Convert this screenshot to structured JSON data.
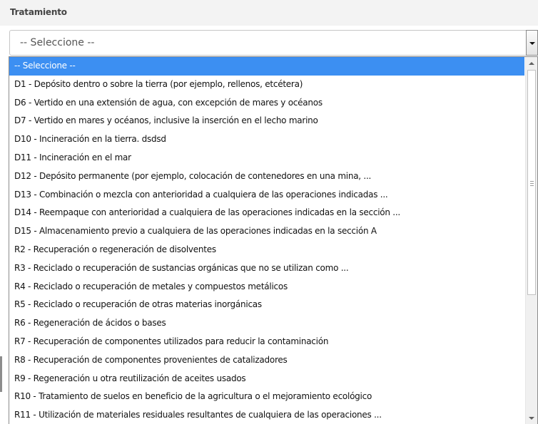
{
  "field": {
    "label": "Tratamiento",
    "selected_value": "-- Seleccione --"
  },
  "dropdown": {
    "options": [
      "-- Seleccione --",
      "D1 - Depósito dentro o sobre la tierra (por ejemplo, rellenos, etcétera)",
      "D6 - Vertido en una extensión de agua, con excepción de mares y océanos",
      "D7 - Vertido en mares y océanos, inclusive la inserción en el lecho marino",
      "D10 - Incineración en la tierra. dsdsd",
      "D11 - Incineración en el mar",
      "D12 - Depósito permanente (por ejemplo, colocación de contenedores en una mina, ...",
      "D13 - Combinación o mezcla con anterioridad a cualquiera de las operaciones indicadas ...",
      "D14 - Reempaque con anterioridad a cualquiera de las operaciones indicadas en la sección ...",
      "D15 - Almacenamiento previo a cualquiera de las operaciones indicadas en la sección A",
      "R2 - Recuperación o regeneración de disolventes",
      "R3 - Reciclado o recuperación de sustancias orgánicas que no se utilizan como ...",
      "R4 - Reciclado o recuperación de metales y compuestos metálicos",
      "R5 - Reciclado o recuperación de otras materias inorgánicas",
      "R6 - Regeneración de ácidos o bases",
      "R7 - Recuperación de componentes utilizados para reducir la contaminación",
      "R8 - Recuperación de componentes provenientes de catalizadores",
      "R9 - Regeneración u otra reutilización de aceites usados",
      "R10 - Tratamiento de suelos en beneficio de la agricultura o el mejoramiento ecológico",
      "R11 - Utilización de materiales residuales resultantes de cualquiera de las operaciones ..."
    ],
    "highlighted_index": 0
  },
  "icons": {
    "select_arrow": "chevron-down-icon",
    "scroll_up": "scroll-up-arrow-icon",
    "scroll_down": "scroll-down-arrow-icon"
  },
  "colors": {
    "highlight": "#3c8ff2",
    "label": "#444444"
  }
}
